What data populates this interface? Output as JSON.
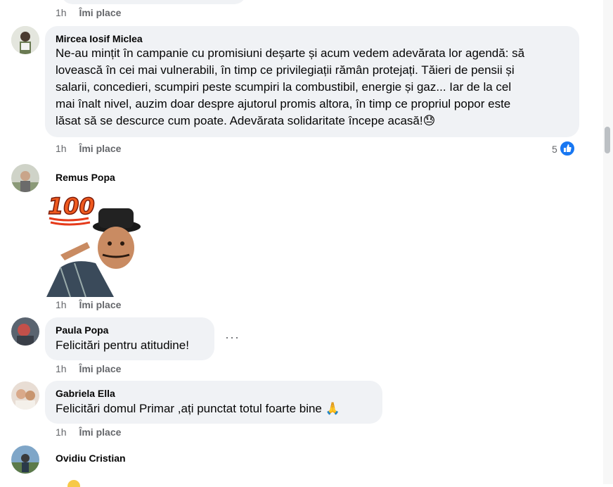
{
  "comments": [
    {
      "time": "1h",
      "like_label": "Îmi place"
    },
    {
      "author": "Mircea Iosif Miclea",
      "lines": [
        "Ne-au mințit în campanie cu promisiuni deșarte și acum vedem adevărata lor agendă: să",
        "lovească în cei mai vulnerabili, în timp ce privilegiații rămân protejați. Tăieri de pensii și",
        "salarii, concedieri, scumpiri peste scumpiri la combustibil, energie și gaz... Iar de la cel",
        "mai înalt nivel, auzim doar despre ajutorul promis altora, în timp ce propriul popor este",
        "lăsat să se descurce cum poate. Adevărata solidaritate începe acasă!😓"
      ],
      "time": "1h",
      "like_label": "Îmi place",
      "reaction_count": "5"
    },
    {
      "author": "Remus Popa",
      "sticker": "100",
      "time": "1h",
      "like_label": "Îmi place"
    },
    {
      "author": "Paula Popa",
      "text": "Felicitări pentru atitudine!",
      "time": "1h",
      "like_label": "Îmi place",
      "more": "···"
    },
    {
      "author": "Gabriela Ella",
      "text": "Felicitări domul Primar ,ați punctat totul foarte bine 🙏",
      "time": "1h",
      "like_label": "Îmi place"
    },
    {
      "author": "Ovidiu Cristian"
    }
  ],
  "colors": {
    "bubble": "#f0f2f5",
    "meta": "#65676b",
    "accent": "#1877f2"
  }
}
